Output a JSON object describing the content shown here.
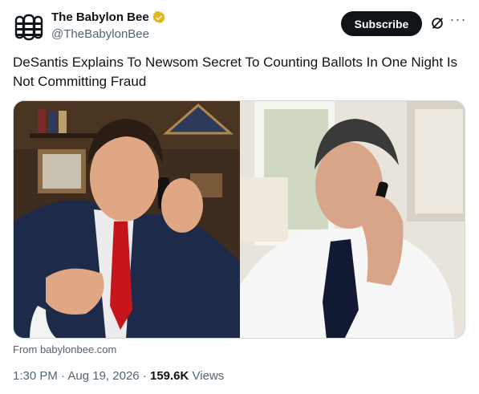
{
  "account": {
    "name": "The Babylon Bee",
    "handle": "@TheBabylonBee",
    "verified_icon": "verified-badge-icon",
    "avatar_icon": "bee-logo-icon"
  },
  "actions": {
    "subscribe_label": "Subscribe",
    "grok_icon": "grok-icon",
    "more_icon": "more-icon"
  },
  "tweet": {
    "text": "DeSantis Explains To Newsom Secret To Counting Ballots In One Night Is Not Committing Fraud",
    "source_label": "From babylonbee.com",
    "time": "1:30 PM",
    "date": "Aug 19, 2026",
    "views_count": "159.6K",
    "views_label": "Views"
  },
  "colors": {
    "text": "#0f1419",
    "secondary": "#536471",
    "verified_gold": "#e2b719",
    "button_bg": "#0f1419"
  }
}
